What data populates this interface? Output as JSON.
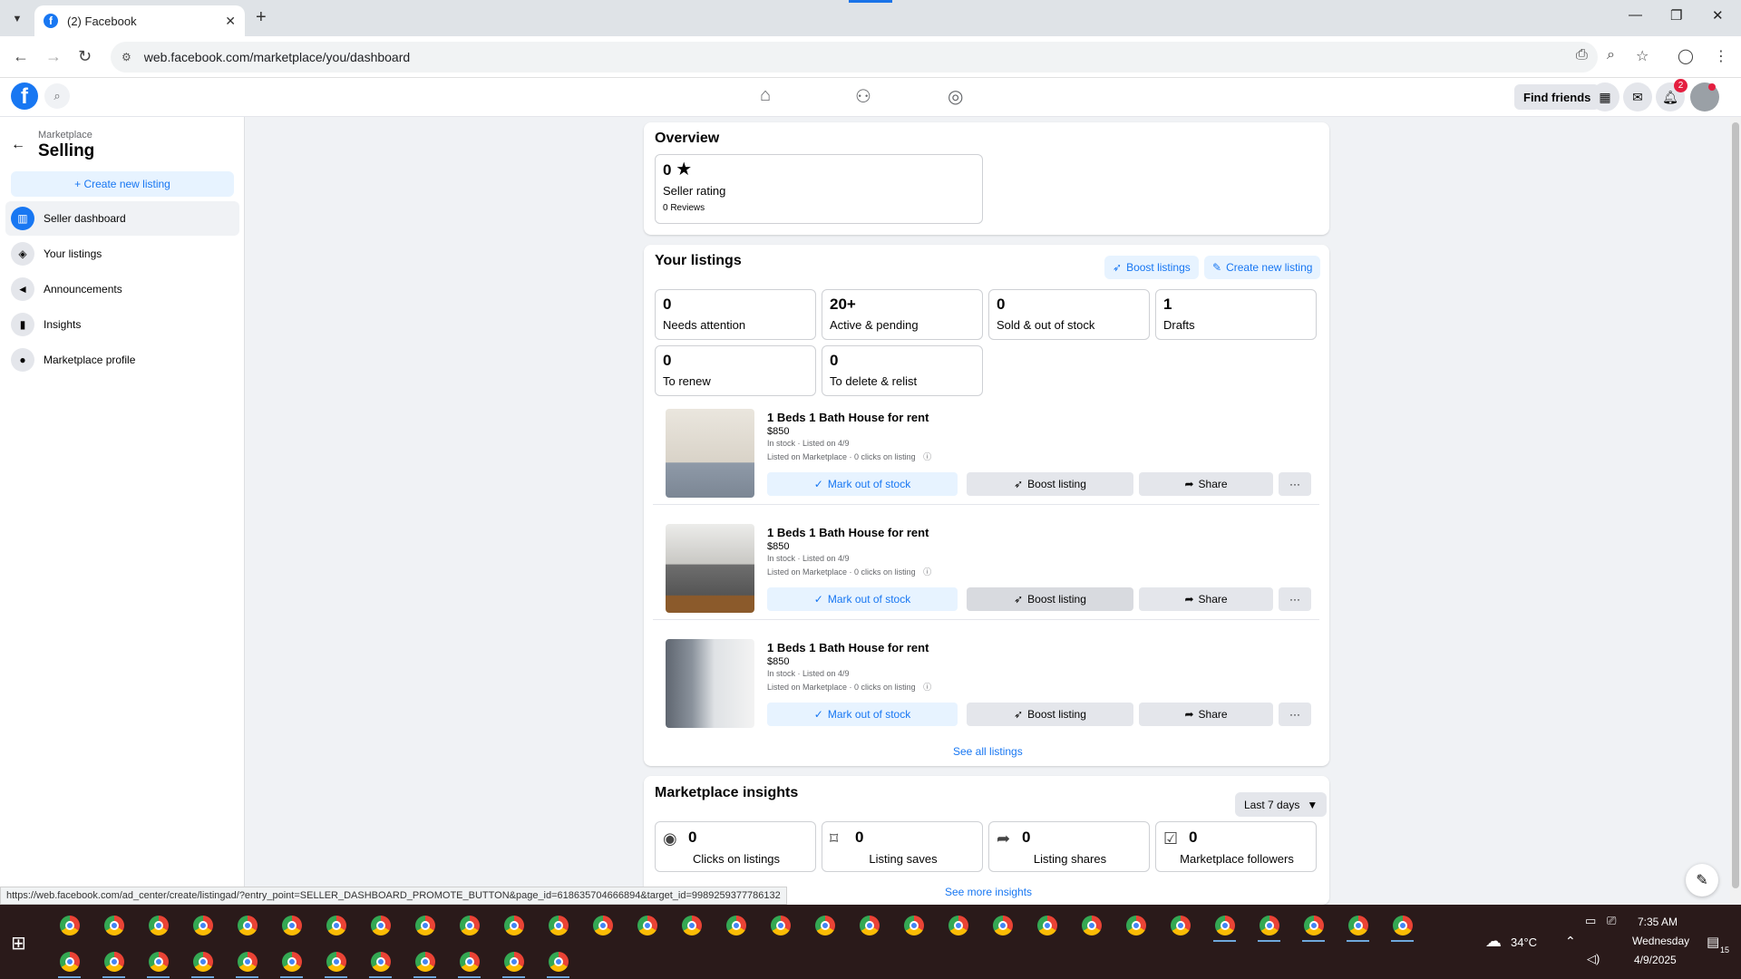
{
  "browser": {
    "tab_title": "(2) Facebook",
    "url": "web.facebook.com/marketplace/you/dashboard"
  },
  "header": {
    "find_friends": "Find friends",
    "notification_count": "2"
  },
  "sidebar": {
    "section": "Marketplace",
    "title": "Selling",
    "create_label": "+ Create new listing",
    "items": [
      {
        "label": "Seller dashboard",
        "icon": "dashboard-icon"
      },
      {
        "label": "Your listings",
        "icon": "tag-icon"
      },
      {
        "label": "Announcements",
        "icon": "megaphone-icon"
      },
      {
        "label": "Insights",
        "icon": "bar-chart-icon"
      },
      {
        "label": "Marketplace profile",
        "icon": "person-icon"
      }
    ]
  },
  "overview": {
    "title": "Overview",
    "rating_value": "0",
    "rating_label": "Seller rating",
    "reviews": "0 Reviews"
  },
  "your_listings": {
    "title": "Your listings",
    "boost_label": "Boost listings",
    "create_label": "Create new listing",
    "stats": [
      {
        "value": "0",
        "label": "Needs attention"
      },
      {
        "value": "20+",
        "label": "Active & pending"
      },
      {
        "value": "0",
        "label": "Sold & out of stock"
      },
      {
        "value": "1",
        "label": "Drafts"
      },
      {
        "value": "0",
        "label": "To renew"
      },
      {
        "value": "0",
        "label": "To delete & relist"
      }
    ],
    "listings": [
      {
        "title": "1 Beds 1 Bath House for rent",
        "price": "$850",
        "status": "In stock · Listed on 4/9",
        "meta": "Listed on Marketplace · 0 clicks on listing"
      },
      {
        "title": "1 Beds 1 Bath House for rent",
        "price": "$850",
        "status": "In stock · Listed on 4/9",
        "meta": "Listed on Marketplace · 0 clicks on listing"
      },
      {
        "title": "1 Beds 1 Bath House for rent",
        "price": "$850",
        "status": "In stock · Listed on 4/9",
        "meta": "Listed on Marketplace · 0 clicks on listing"
      }
    ],
    "actions": {
      "mark": "Mark out of stock",
      "boost": "Boost listing",
      "share": "Share",
      "more": "···"
    },
    "see_all": "See all listings"
  },
  "insights": {
    "title": "Marketplace insights",
    "range": "Last 7 days",
    "stats": [
      {
        "value": "0",
        "label": "Clicks on listings",
        "icon": "eye-icon"
      },
      {
        "value": "0",
        "label": "Listing saves",
        "icon": "bookmark-icon"
      },
      {
        "value": "0",
        "label": "Listing shares",
        "icon": "share-icon"
      },
      {
        "value": "0",
        "label": "Marketplace followers",
        "icon": "followers-icon"
      }
    ],
    "see_more": "See more insights"
  },
  "status_bar_url": "https://web.facebook.com/ad_center/create/listingad/?entry_point=SELLER_DASHBOARD_PROMOTE_BUTTON&page_id=618635704666894&target_id=9989259377786132",
  "taskbar": {
    "temperature": "34°C",
    "time": "7:35 AM",
    "day": "Wednesday",
    "date": "4/9/2025",
    "notif_count": "15"
  }
}
